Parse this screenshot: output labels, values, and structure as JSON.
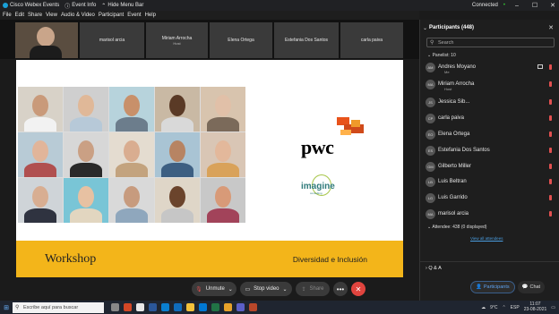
{
  "titlebar": {
    "app": "Cisco Webex Events",
    "event_info": "Event Info",
    "hide_menu": "Hide Menu Bar",
    "status": "Connected",
    "status_arrow": "•"
  },
  "menu": [
    "File",
    "Edit",
    "Share",
    "View",
    "Audio & Video",
    "Participant",
    "Event",
    "Help"
  ],
  "videos": [
    {
      "name": "marisol arcia",
      "sub": ""
    },
    {
      "name": "Miriam Arrocha",
      "sub": "Host"
    },
    {
      "name": "Elena Ortega",
      "sub": ""
    },
    {
      "name": "Estefania Dos Santos",
      "sub": ""
    },
    {
      "name": "carla paiva",
      "sub": ""
    }
  ],
  "slide": {
    "brand1": "pwc",
    "brand2": "imagine",
    "brand2_sub": "consulting",
    "banner_left": "Workshop",
    "banner_right": "Diversidad e Inclusión",
    "colors": {
      "banner": "#f3b51a",
      "pwc_orange": "#e8531b"
    }
  },
  "controls": {
    "unmute": "Unmute",
    "stop_video": "Stop video",
    "share": "Share",
    "more": "•••",
    "end": "✕"
  },
  "panel": {
    "title": "Participants (448)",
    "search_placeholder": "Search",
    "panelists_label": "Panelist: 10",
    "attendees_label": "Attendee: 438 (0 displayed)",
    "view_all": "View all attendees",
    "qa": "Q & A",
    "tab_participants": "Participants",
    "tab_chat": "Chat"
  },
  "panelists": [
    {
      "initials": "AM",
      "name": "Andres Moyano",
      "role": "Me"
    },
    {
      "initials": "MA",
      "name": "Miriam Arrocha",
      "role": "Host"
    },
    {
      "initials": "JS",
      "name": "Jessica Sib...",
      "role": ""
    },
    {
      "initials": "CP",
      "name": "carla paiva",
      "role": ""
    },
    {
      "initials": "EO",
      "name": "Elena Ortega",
      "role": ""
    },
    {
      "initials": "ES",
      "name": "Estefania Dos Santos",
      "role": ""
    },
    {
      "initials": "GM",
      "name": "Gilberto Miller",
      "role": ""
    },
    {
      "initials": "LB",
      "name": "Luis Beltran",
      "role": ""
    },
    {
      "initials": "LG",
      "name": "Luis Garrido",
      "role": ""
    },
    {
      "initials": "MA",
      "name": "marisol arcia",
      "role": ""
    }
  ],
  "taskbar": {
    "search": "Escribe aquí para buscar",
    "weather": "9°C",
    "lang": "ESP",
    "time": "11:07",
    "date": "23-08-2021"
  }
}
